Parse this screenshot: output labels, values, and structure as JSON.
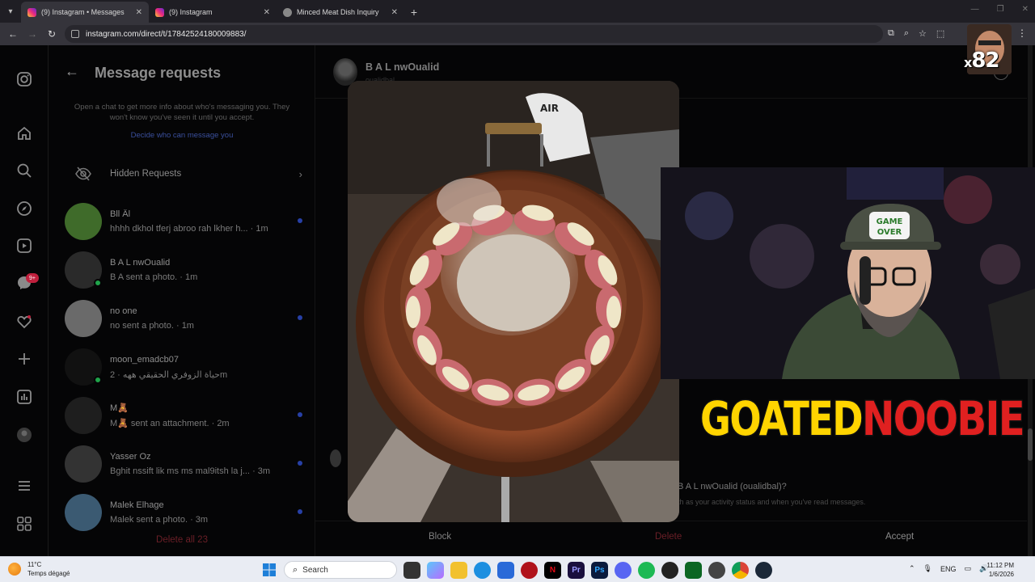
{
  "browser": {
    "tabs": [
      {
        "label": "(9) Instagram • Messages",
        "active": true,
        "icon": "instagram-icon"
      },
      {
        "label": "(9) Instagram",
        "active": false,
        "icon": "instagram-icon"
      },
      {
        "label": "Minced Meat Dish Inquiry",
        "active": false,
        "icon": "globe-icon"
      }
    ],
    "new_tab": "+",
    "url": "instagram.com/direct/t/17842524180009883/"
  },
  "sidebar": {
    "badge": "9+"
  },
  "requests": {
    "title": "Message requests",
    "subtitle": "Open a chat to get more info about who's messaging you. They won't know you've seen it until you accept.",
    "link": "Decide who can message you",
    "hidden_label": "Hidden Requests",
    "items": [
      {
        "name": "Bll Âl",
        "message": "hhhh dkhol tferj abroo rah lkher h...",
        "time": "· 1m",
        "unread": true,
        "online": false,
        "avatar_color": "#3f6b2a"
      },
      {
        "name": "B A L nwOualid",
        "message": "B A sent a photo.",
        "time": "· 1m",
        "unread": false,
        "online": true,
        "avatar_color": "#2a2a2a"
      },
      {
        "name": "no one",
        "message": "no sent a photo.",
        "time": "· 1m",
        "unread": true,
        "online": false,
        "avatar_color": "#6a6a6a"
      },
      {
        "name": "moon_emadcb07",
        "message": "حياة الزوفري الحقيقي ههه",
        "time": "· 2m",
        "unread": false,
        "online": true,
        "avatar_color": "#111111"
      },
      {
        "name": "M🧸",
        "message": "M🧸 sent an attachment.",
        "time": "· 2m",
        "unread": true,
        "online": false,
        "avatar_color": "#1e1e1e"
      },
      {
        "name": "Yasser Oz",
        "message": "Bghit nssift lik ms ms mal9itsh la j...",
        "time": "· 3m",
        "unread": true,
        "online": false,
        "avatar_color": "#333333"
      },
      {
        "name": "Malek Elhage",
        "message": "Malek sent a photo.",
        "time": "· 3m",
        "unread": true,
        "online": false,
        "avatar_color": "#3b5a72"
      }
    ],
    "delete_all": "Delete all 23"
  },
  "thread": {
    "name": "B A L nwOualid",
    "username": "oualidbal",
    "accept_question": "B A L nwOualid (oualidbal)?",
    "accept_sub": "th as your activity status and when you've read messages.",
    "actions": {
      "block": "Block",
      "delete": "Delete",
      "accept": "Accept"
    }
  },
  "overlay": {
    "brand_part1": "GOATED",
    "brand_part2": "NOOBIE",
    "multiplier_prefix": "x",
    "multiplier_value": "82"
  },
  "taskbar": {
    "weather_temp": "11°C",
    "weather_desc": "Temps dégagé",
    "search": "Search",
    "lang": "ENG",
    "time": "11:12 PM",
    "date": "1/6/2026"
  },
  "colors": {
    "accent_blue": "#2740a6",
    "delete_red": "#6b1f27",
    "online_green": "#1fa34a",
    "brand_yellow": "#ffd400",
    "brand_red": "#e02020"
  }
}
